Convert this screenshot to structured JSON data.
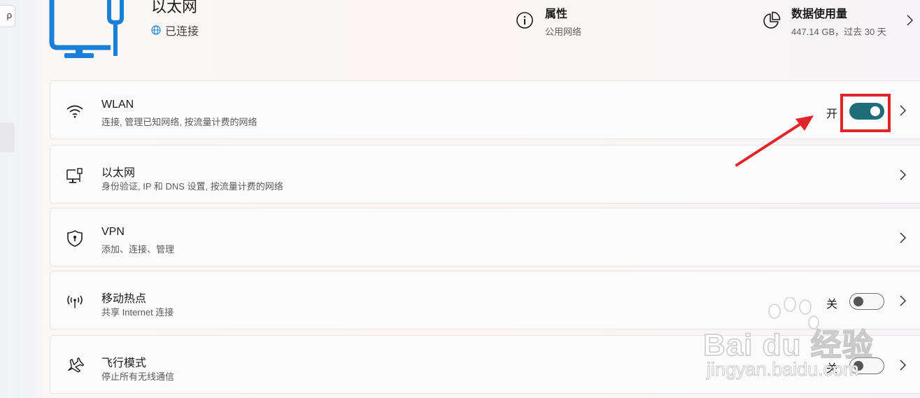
{
  "sidebar": {
    "search_glyph": "ρ"
  },
  "header": {
    "connection_title": "以太网",
    "connection_status": "已连接",
    "properties": {
      "label": "属性",
      "value": "公用网络"
    },
    "data_usage": {
      "label": "数据使用量",
      "value": "447.14 GB，过去 30 天"
    }
  },
  "cards": [
    {
      "icon": "wifi-icon",
      "title": "WLAN",
      "subtitle": "连接, 管理已知网络, 按流量计费的网络",
      "toggle_label": "开",
      "toggle_on": true
    },
    {
      "icon": "ethernet-icon",
      "title": "以太网",
      "subtitle": "身份验证, IP 和 DNS 设置, 按流量计费的网络"
    },
    {
      "icon": "vpn-shield-icon",
      "title": "VPN",
      "subtitle": "添加、连接、管理"
    },
    {
      "icon": "hotspot-icon",
      "title": "移动热点",
      "subtitle": "共享 Internet 连接",
      "toggle_label": "关",
      "toggle_on": false
    },
    {
      "icon": "airplane-icon",
      "title": "飞行模式",
      "subtitle": "停止所有无线通信",
      "toggle_label": "关",
      "toggle_on": false
    }
  ],
  "watermark": {
    "brand": "Bai du 经验",
    "url": "jingyan.baidu.com"
  },
  "colors": {
    "accent": "#1f6d79",
    "annotation": "#e0242a",
    "icon_blue": "#1a7fd6"
  }
}
